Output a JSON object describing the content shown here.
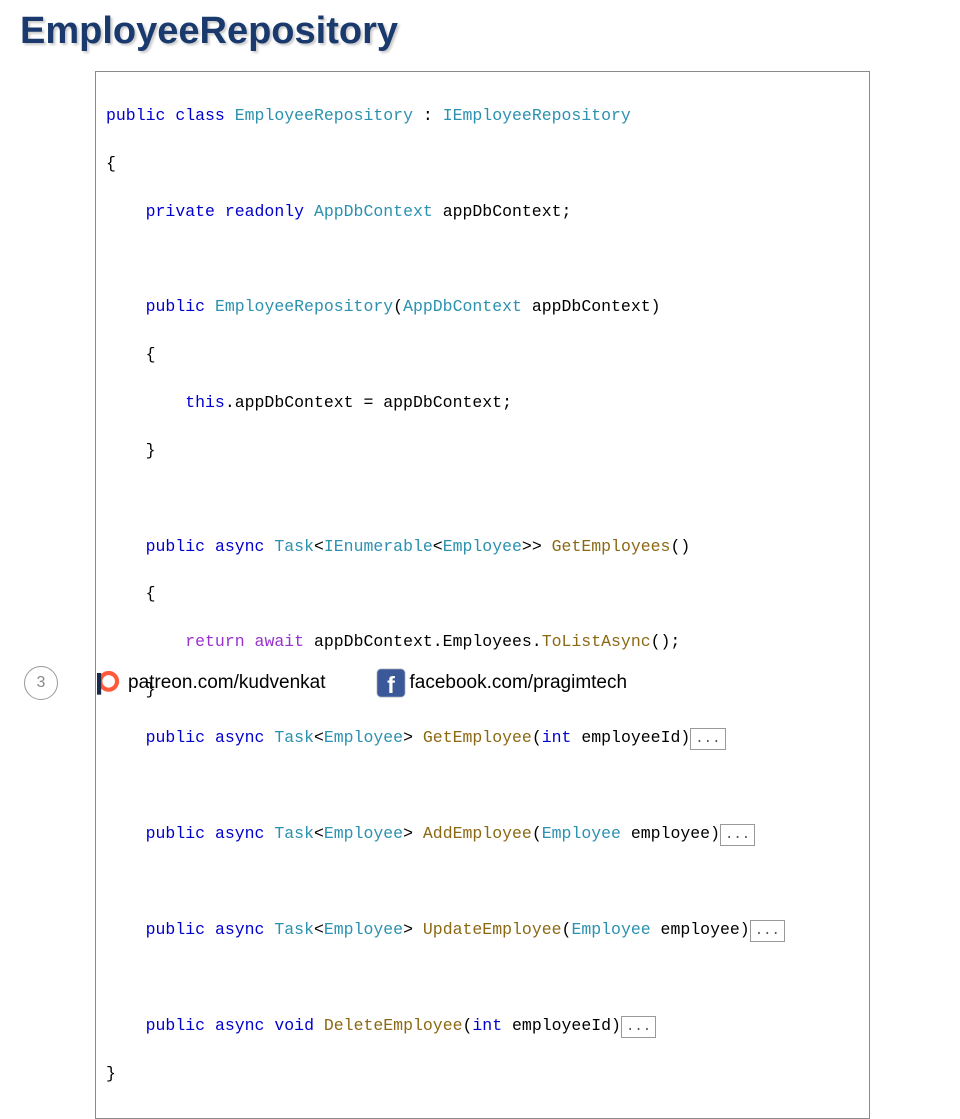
{
  "title": "EmployeeRepository",
  "code": {
    "l1_public": "public",
    "l1_class": "class",
    "l1_typename": "EmployeeRepository",
    "l1_colon": " : ",
    "l1_iface": "IEmployeeRepository",
    "brace_open": "{",
    "l2_private": "private",
    "l2_readonly": "readonly",
    "l2_type": "AppDbContext",
    "l2_ident": "appDbContext;",
    "ctor_public": "public",
    "ctor_name": "EmployeeRepository",
    "ctor_paren_open": "(",
    "ctor_ptype": "AppDbContext",
    "ctor_pname": "appDbContext)",
    "brace_open2": "{",
    "assign_this": "this",
    "assign_rest": ".appDbContext = appDbContext;",
    "brace_close2": "}",
    "m1_public": "public",
    "m1_async": "async",
    "m1_task": "Task",
    "m1_lt": "<",
    "m1_ienum": "IEnumerable",
    "m1_lt2": "<",
    "m1_emp": "Employee",
    "m1_gt2": ">>",
    "m1_name": " GetEmployees",
    "m1_paren": "()",
    "m1b_open": "{",
    "m1_return": "return",
    "m1_await": "await",
    "m1_expr_a": " appDbContext.Employees.",
    "m1_tolist": "ToListAsync",
    "m1_expr_b": "();",
    "m1b_close": "}",
    "m2_public": "public",
    "m2_async": "async",
    "m2_task": "Task",
    "m2_lt": "<",
    "m2_emp": "Employee",
    "m2_gt": ">",
    "m2_name": " GetEmployee",
    "m2_p": "(",
    "m2_int": "int",
    "m2_pn": " employeeId)",
    "m3_public": "public",
    "m3_async": "async",
    "m3_task": "Task",
    "m3_lt": "<",
    "m3_emp": "Employee",
    "m3_gt": ">",
    "m3_name": " AddEmployee",
    "m3_p": "(",
    "m3_ptype": "Employee",
    "m3_pn": " employee)",
    "m4_public": "public",
    "m4_async": "async",
    "m4_task": "Task",
    "m4_lt": "<",
    "m4_emp": "Employee",
    "m4_gt": ">",
    "m4_name": " UpdateEmployee",
    "m4_p": "(",
    "m4_ptype": "Employee",
    "m4_pn": " employee)",
    "m5_public": "public",
    "m5_async": "async",
    "m5_void": "void",
    "m5_name": " DeleteEmployee",
    "m5_p": "(",
    "m5_int": "int",
    "m5_pn": " employeeId)",
    "brace_close": "}",
    "fold": "..."
  },
  "footer": {
    "page": "3",
    "patreon": "patreon.com/kudvenkat",
    "facebook": "facebook.com/pragimtech"
  }
}
